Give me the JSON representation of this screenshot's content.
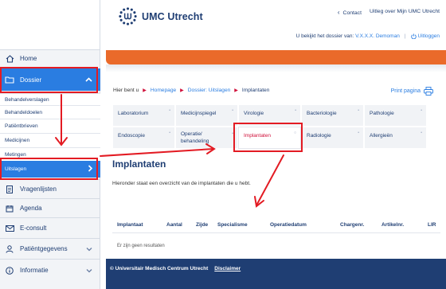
{
  "header": {
    "brand": "UMC Utrecht",
    "contact": "Contact",
    "uitleg": "Uitleg over Mijn UMC Utrecht",
    "dossier_prefix": "U bekijkt het dossier van:",
    "dossier_person": "V.X.X.X. Demoman",
    "logout": "Uitloggen"
  },
  "sidebar": {
    "home": "Home",
    "dossier": "Dossier",
    "sub": [
      "Behandelverslagen",
      "Behandeldoelen",
      "Patiëntbrieven",
      "Medicijnen",
      "Metingen",
      "Uitslagen"
    ],
    "items": [
      "Vragenlijsten",
      "Agenda",
      "E-consult",
      "Patiëntgegevens",
      "Informatie"
    ]
  },
  "breadcrumb": {
    "prefix": "Hier bent u",
    "homepage": "Homepage",
    "uitslagen": "Dossier: Uitslagen",
    "current": "Implantaten"
  },
  "print_label": "Print pagina",
  "grid": [
    "Laboratorium",
    "Medicijnspiegel",
    "Virologie",
    "Bacteriologie",
    "Pathologie",
    "Endoscopie",
    "Operatie/ behandeling",
    "Implantaten",
    "Radiologie",
    "Allergieën"
  ],
  "content": {
    "title": "Implantaten",
    "intro": "Hieronder staat een overzicht van de implantaten die u hebt.",
    "columns": [
      "Implantaat",
      "Aantal",
      "Zijde",
      "Specialisme",
      "Operatiedatum",
      "Chargenr.",
      "Artikelnr.",
      "LIR"
    ],
    "empty": "Er zijn geen resultaten"
  },
  "footer": {
    "copyright": "© Universitair Medisch Centrum Utrecht",
    "disclaimer": "Disclaimer"
  },
  "colors": {
    "navy": "#1f3e73",
    "blue": "#2a7de1",
    "orange": "#ea6a2a",
    "annotation_red": "#e31b23"
  }
}
